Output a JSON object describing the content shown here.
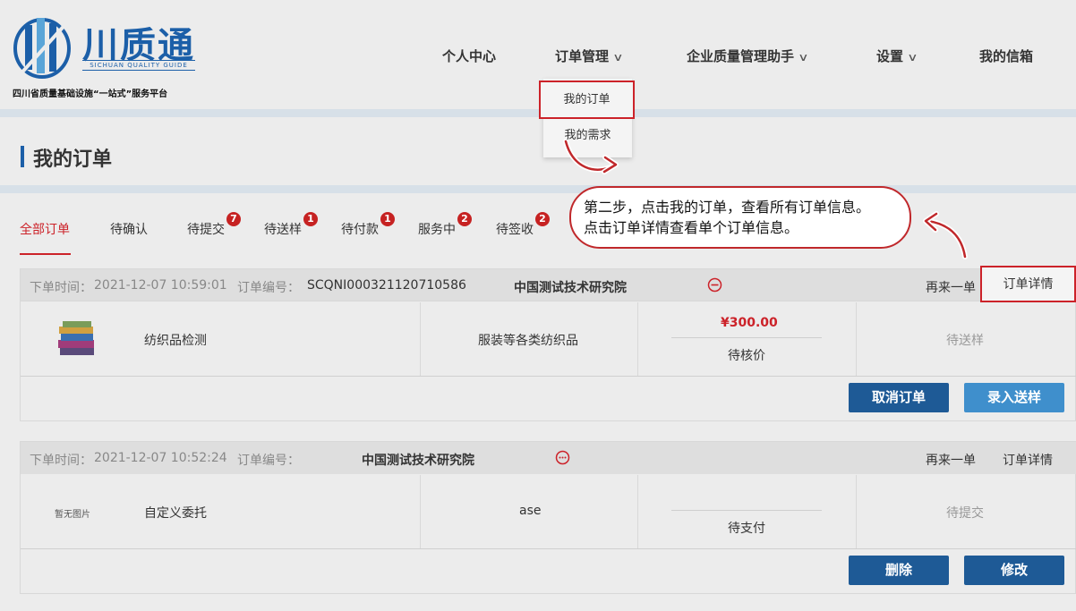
{
  "brand": {
    "name": "川质通",
    "english": "SICHUAN QUALITY GUIDE",
    "subtitle": "四川省质量基础设施“一站式”服务平台",
    "colors": {
      "primary": "#1c5fa8",
      "accent": "#cc2229"
    }
  },
  "nav": {
    "personal": "个人中心",
    "orders": "订单管理",
    "assistant": "企业质量管理助手",
    "settings": "设置",
    "mailbox": "我的信箱"
  },
  "dropdown": {
    "my_orders": "我的订单",
    "my_demands": "我的需求"
  },
  "page": {
    "title": "我的订单"
  },
  "tabs": [
    {
      "label": "全部订单",
      "badge": null
    },
    {
      "label": "待确认",
      "badge": null
    },
    {
      "label": "待提交",
      "badge": "7"
    },
    {
      "label": "待送样",
      "badge": "1"
    },
    {
      "label": "待付款",
      "badge": "1"
    },
    {
      "label": "服务中",
      "badge": "2"
    },
    {
      "label": "待签收",
      "badge": "2"
    }
  ],
  "callout": {
    "line1": "第二步，点击我的订单，查看所有订单信息。",
    "line2": "点击订单详情查看单个订单信息。"
  },
  "orders": [
    {
      "time_label": "下单时间：",
      "time": "2021-12-07 10:59:01",
      "number_label": "订单编号：",
      "number": "SCQNI000321120710586",
      "org": "中国测试技术研究院",
      "reorder": "再来一单",
      "detail": "订单详情",
      "product": "纺织品检测",
      "category": "服装等各类纺织品",
      "price": "¥300.00",
      "price_status": "待核价",
      "status": "待送样",
      "btn1": "取消订单",
      "btn2": "录入送样"
    },
    {
      "time_label": "下单时间：",
      "time": "2021-12-07 10:52:24",
      "number_label": "订单编号：",
      "number": "",
      "org": "中国测试技术研究院",
      "reorder": "再来一单",
      "detail": "订单详情",
      "no_image": "暂无图片",
      "product": "自定义委托",
      "category": "ase",
      "price": "",
      "price_status": "待支付",
      "status": "待提交",
      "btn1": "删除",
      "btn2": "修改"
    }
  ]
}
